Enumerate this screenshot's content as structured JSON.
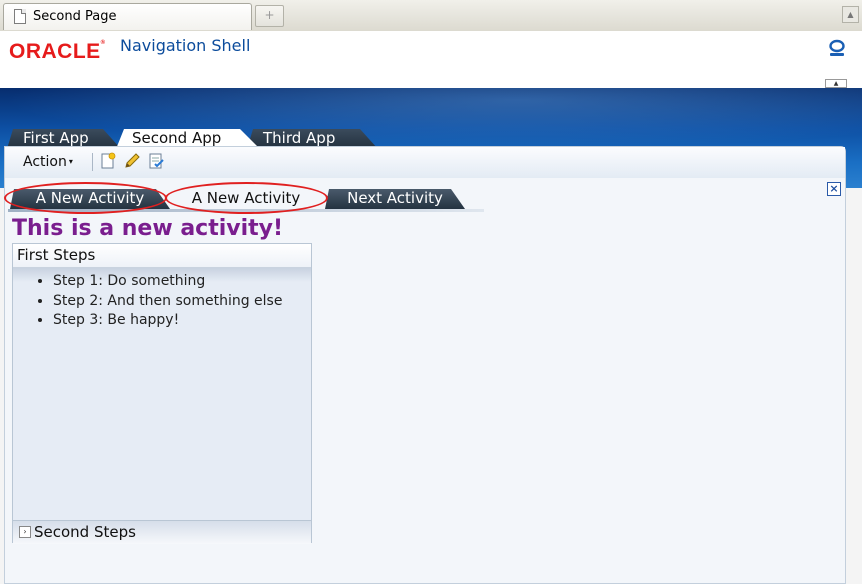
{
  "browser": {
    "tab_title": "Second Page",
    "new_tab_glyph": "+",
    "scroll_glyph": "▲"
  },
  "header": {
    "logo_text": "ORACLE",
    "logo_mark": "®",
    "title": "Navigation Shell",
    "scroll_glyph": "▲"
  },
  "app_tabs": [
    {
      "label": "First App",
      "active": false
    },
    {
      "label": "Second App",
      "active": true
    },
    {
      "label": "Third App",
      "active": false
    }
  ],
  "toolbar": {
    "action_label": "Action",
    "caret": "▾",
    "icons": [
      "new-document-icon",
      "edit-pencil-icon",
      "checklist-icon"
    ]
  },
  "activity_tabs": [
    {
      "label": "A New Activity",
      "active": false,
      "highlighted": true
    },
    {
      "label": "A New Activity",
      "active": true,
      "highlighted": true
    },
    {
      "label": "Next Activity",
      "active": false,
      "highlighted": false
    }
  ],
  "close_glyph": "×",
  "activity": {
    "heading": "This is a new activity!"
  },
  "accordion": {
    "first_title": "First Steps",
    "steps": [
      "Step 1: Do something",
      "Step 2: And then something else",
      "Step 3: Be happy!"
    ],
    "second_title": "Second Steps",
    "expand_glyph": "›"
  },
  "colors": {
    "brand_red": "#e61b1b",
    "heading_purple": "#7a1e8e",
    "title_blue": "#0c4c9c",
    "highlight_red": "#e02020"
  }
}
